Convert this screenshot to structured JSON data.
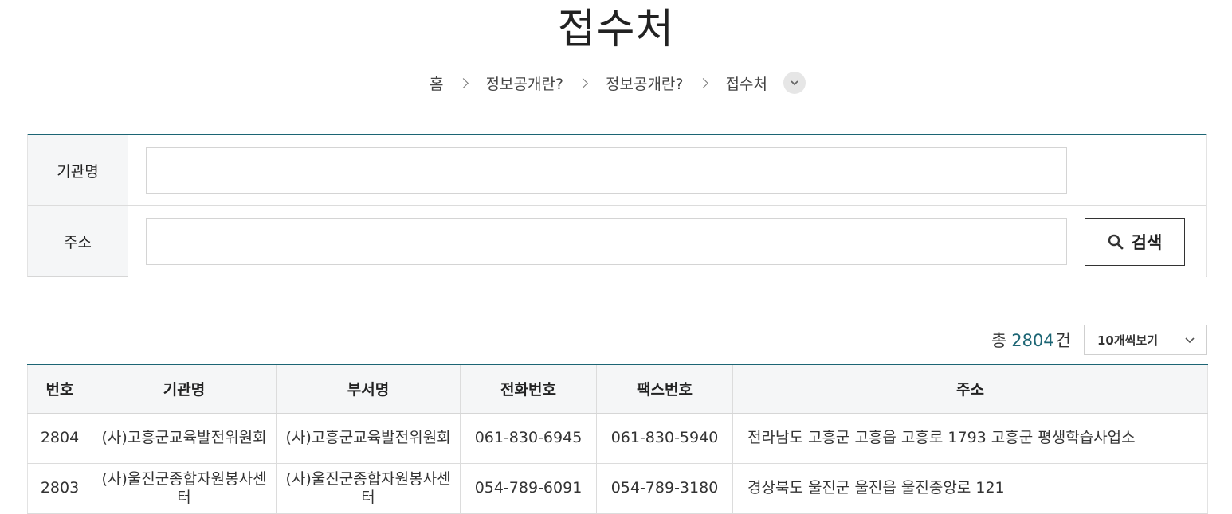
{
  "page": {
    "title": "접수처"
  },
  "breadcrumb": {
    "items": [
      "홈",
      "정보공개란?",
      "정보공개란?",
      "접수처"
    ]
  },
  "search": {
    "org_label": "기관명",
    "org_value": "",
    "addr_label": "주소",
    "addr_value": "",
    "button_label": "검색"
  },
  "results": {
    "total_prefix": "총",
    "total_count": "2804",
    "total_suffix": "건",
    "per_page": "10개씩보기"
  },
  "table": {
    "headers": [
      "번호",
      "기관명",
      "부서명",
      "전화번호",
      "팩스번호",
      "주소"
    ],
    "rows": [
      [
        "2804",
        "(사)고흥군교육발전위원회",
        "(사)고흥군교육발전위원회",
        "061-830-6945",
        "061-830-5940",
        "전라남도 고흥군 고흥읍 고흥로 1793 고흥군 평생학습사업소"
      ],
      [
        "2803",
        "(사)울진군종합자원봉사센터",
        "(사)울진군종합자원봉사센터",
        "054-789-6091",
        "054-789-3180",
        "경상북도 울진군 울진읍 울진중앙로 121"
      ]
    ]
  },
  "colors": {
    "accent": "#1c6574",
    "header_bg": "#f5f6f7"
  },
  "icons": [
    "chevron-right-icon",
    "chevron-down-icon",
    "search-icon"
  ]
}
